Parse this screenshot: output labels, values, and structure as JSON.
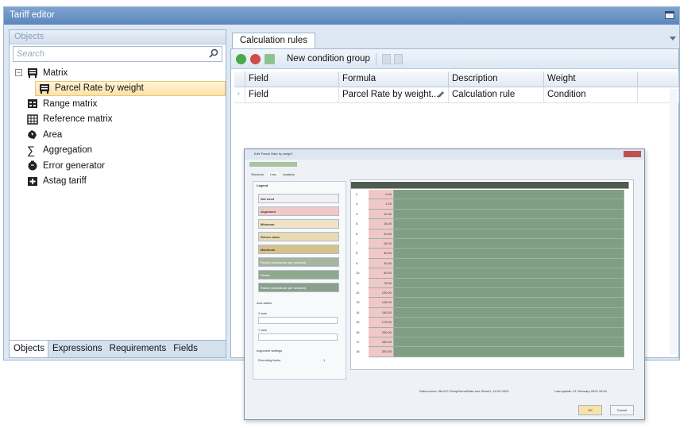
{
  "window": {
    "title": "Tariff editor"
  },
  "left_panel": {
    "header": "Objects",
    "search_placeholder": "Search",
    "tree": [
      {
        "label": "Matrix",
        "icon": "matrix-icon",
        "expander": "−"
      },
      {
        "label": "Parcel Rate by weight",
        "icon": "matrix-icon"
      },
      {
        "label": "Range matrix",
        "icon": "range-matrix-icon"
      },
      {
        "label": "Reference matrix",
        "icon": "reference-matrix-icon"
      },
      {
        "label": "Area",
        "icon": "area-icon"
      },
      {
        "label": "Aggregation",
        "icon": "sigma-icon",
        "glyph": "∑"
      },
      {
        "label": "Error generator",
        "icon": "error-generator-icon"
      },
      {
        "label": "Astag tariff",
        "icon": "astag-tariff-icon"
      }
    ],
    "tabs": [
      "Objects",
      "Expressions",
      "Requirements",
      "Fields"
    ]
  },
  "right_panel": {
    "tab": "Calculation rules",
    "toolbar": {
      "new_condition_group": "New condition group"
    },
    "grid": {
      "headers": [
        "Field",
        "Formula",
        "Description",
        "Weight"
      ],
      "rows": [
        {
          "field": "Field",
          "formula": "Parcel Rate by weight...",
          "description": "Calculation rule",
          "weight": "Condition"
        }
      ]
    }
  },
  "dialog": {
    "title": "Edit 'Parcel Rate by weight'",
    "tabs": [
      "Structure",
      "Data",
      "Analysis"
    ],
    "legend_title": "Legend",
    "legend": [
      {
        "label": "Not used",
        "color": "#f3f0f3"
      },
      {
        "label": "Argument",
        "color": "#f2c9c9"
      },
      {
        "label": "Minimum",
        "color": "#efe2c6"
      },
      {
        "label": "Return value",
        "color": "#e9dcb4"
      },
      {
        "label": "Maximum",
        "color": "#d8c28c"
      },
      {
        "label": "Factor (maximum per column)",
        "color": "#a6b4a0"
      },
      {
        "label": "Factor",
        "color": "#8fa88c"
      },
      {
        "label": "Factor (maximum per column)",
        "color": "#8aa08c"
      }
    ],
    "axis_labels_title": "Axis labels",
    "x_axis": "X axis",
    "y_axis": "Y axis",
    "argument_settings": "Argument settings",
    "rounding_factor": "Rounding factor",
    "rounding_value": "1",
    "status": "Data source: file:///C:/Temp/DemoRate.xlsx Sheet1, 10.02.2023",
    "last_update": "Last update: 21 February 2024 10:00",
    "ok": "OK",
    "cancel": "Cancel",
    "row_numbers": [
      "2",
      "3",
      "4",
      "5",
      "6",
      "7",
      "8",
      "9",
      "10",
      "11",
      "12",
      "13",
      "14",
      "15",
      "16",
      "17",
      "18"
    ],
    "weights": [
      "0.00",
      "1.00",
      "10.00",
      "15.00",
      "20.00",
      "25.00",
      "30.00",
      "40.00",
      "50.00",
      "75.00",
      "100.00",
      "125.00",
      "150.00",
      "175.00",
      "200.00",
      "250.00",
      "300.00"
    ],
    "colors": {
      "argument_col": "#f0c8c8",
      "data_cell": "#7f9f84",
      "header_cell": "#4f5a52"
    }
  }
}
